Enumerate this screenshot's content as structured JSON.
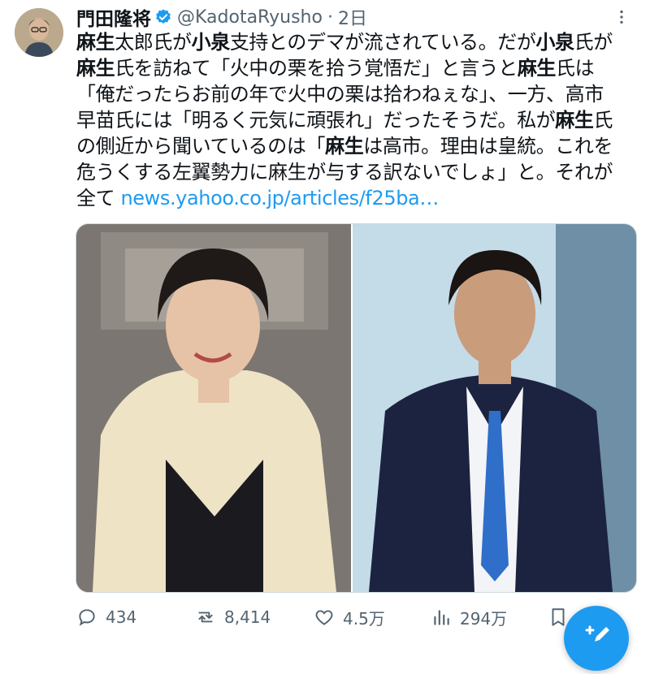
{
  "author": {
    "name": "門田隆将",
    "handle": "@KadotaRyusho",
    "separator": "·",
    "time": "2日"
  },
  "tweet": {
    "lines": [
      [
        "b:麻生",
        "太郎氏が",
        "b:小泉",
        "支持とのデマが流されている。だが",
        "b:小泉",
        "氏が"
      ],
      [
        "b:麻生",
        "氏を訪ねて「火中の栗を拾う覚悟だ」と言うと",
        "b:麻生",
        "氏は"
      ],
      [
        "「俺だったらお前の年で火中の栗は拾わねぇな」、一方、高市"
      ],
      [
        "早苗氏には「明るく元気に頑張れ」だったそうだ。私が",
        "b:麻生",
        "氏"
      ],
      [
        "の側近から聞いているのは「",
        "b:麻生",
        "は高市。理由は皇統。これを"
      ],
      [
        "危うくする左翼勢力に麻生が与する訳ないでしょ」と。それが"
      ],
      [
        "全て ",
        "l:news.yahoo.co.jp/articles/f25ba…"
      ]
    ]
  },
  "stats": {
    "replies": "434",
    "retweets": "8,414",
    "likes": "4.5万",
    "views": "294万"
  },
  "colors": {
    "accent": "#1d9bf0",
    "secondary_text": "#536471"
  },
  "icons": {
    "verified": "verified-badge-icon",
    "more": "more-dots-icon",
    "reply": "reply-icon",
    "retweet": "retweet-icon",
    "like": "heart-icon",
    "views": "views-chart-icon",
    "bookmark": "bookmark-icon",
    "compose": "compose-icon"
  }
}
